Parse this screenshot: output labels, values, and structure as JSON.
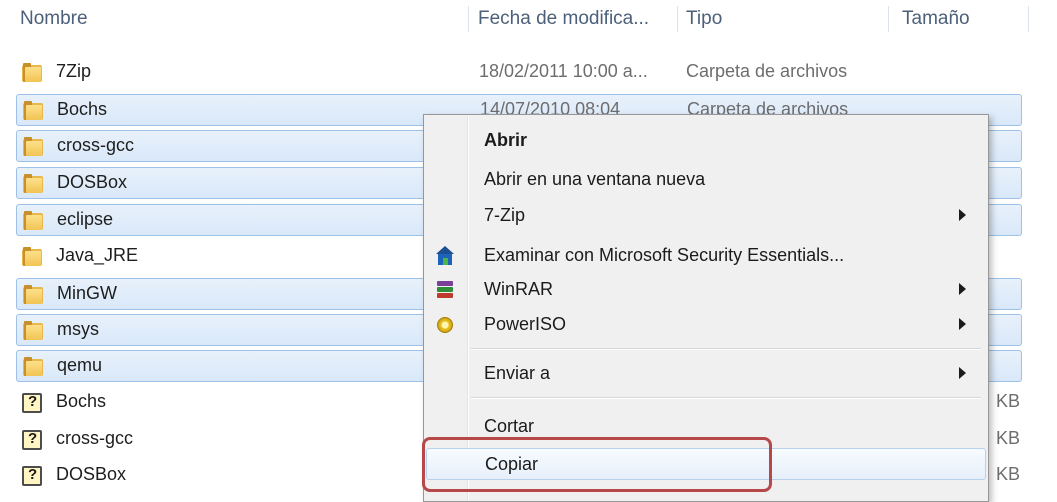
{
  "columns": {
    "name": "Nombre",
    "date": "Fecha de modifica...",
    "type": "Tipo",
    "size": "Tamaño"
  },
  "rows": [
    {
      "name": "7Zip",
      "date": "18/02/2011 10:00 a...",
      "type": "Carpeta de archivos",
      "size": "",
      "icon": "folder-icon",
      "selected": false
    },
    {
      "name": "Bochs",
      "date": "14/07/2010 08:04",
      "type": "Carpeta de archivos",
      "size": "",
      "icon": "folder-icon",
      "selected": true
    },
    {
      "name": "cross-gcc",
      "date": "",
      "type": "",
      "size": "",
      "icon": "folder-icon",
      "selected": true
    },
    {
      "name": "DOSBox",
      "date": "",
      "type": "",
      "size": "",
      "icon": "folder-icon",
      "selected": true
    },
    {
      "name": "eclipse",
      "date": "",
      "type": "",
      "size": "",
      "icon": "folder-icon",
      "selected": true
    },
    {
      "name": "Java_JRE",
      "date": "",
      "type": "",
      "size": "",
      "icon": "folder-icon",
      "selected": false
    },
    {
      "name": "MinGW",
      "date": "",
      "type": "",
      "size": "",
      "icon": "folder-icon",
      "selected": true
    },
    {
      "name": "msys",
      "date": "",
      "type": "",
      "size": "",
      "icon": "folder-icon",
      "selected": true
    },
    {
      "name": "qemu",
      "date": "",
      "type": "",
      "size": "",
      "icon": "folder-icon",
      "selected": true
    },
    {
      "name": "Bochs",
      "date": "",
      "type": "",
      "size": "KB",
      "icon": "help-file-icon",
      "selected": false
    },
    {
      "name": "cross-gcc",
      "date": "",
      "type": "",
      "size": "KB",
      "icon": "help-file-icon",
      "selected": false
    },
    {
      "name": "DOSBox",
      "date": "",
      "type": "",
      "size": "KB",
      "icon": "help-file-icon",
      "selected": false
    }
  ],
  "context_menu": {
    "open": "Abrir",
    "open_new_window": "Abrir en una ventana nueva",
    "seven_zip": "7-Zip",
    "mse_scan": "Examinar con Microsoft Security Essentials...",
    "winrar": "WinRAR",
    "poweriso": "PowerISO",
    "send_to": "Enviar a",
    "cut": "Cortar",
    "copy": "Copiar"
  },
  "colors": {
    "selection_bg": "#d9e8f9",
    "selection_border": "#9dc1e7",
    "highlight_box": "#b6484a",
    "header_text": "#4c607a"
  }
}
